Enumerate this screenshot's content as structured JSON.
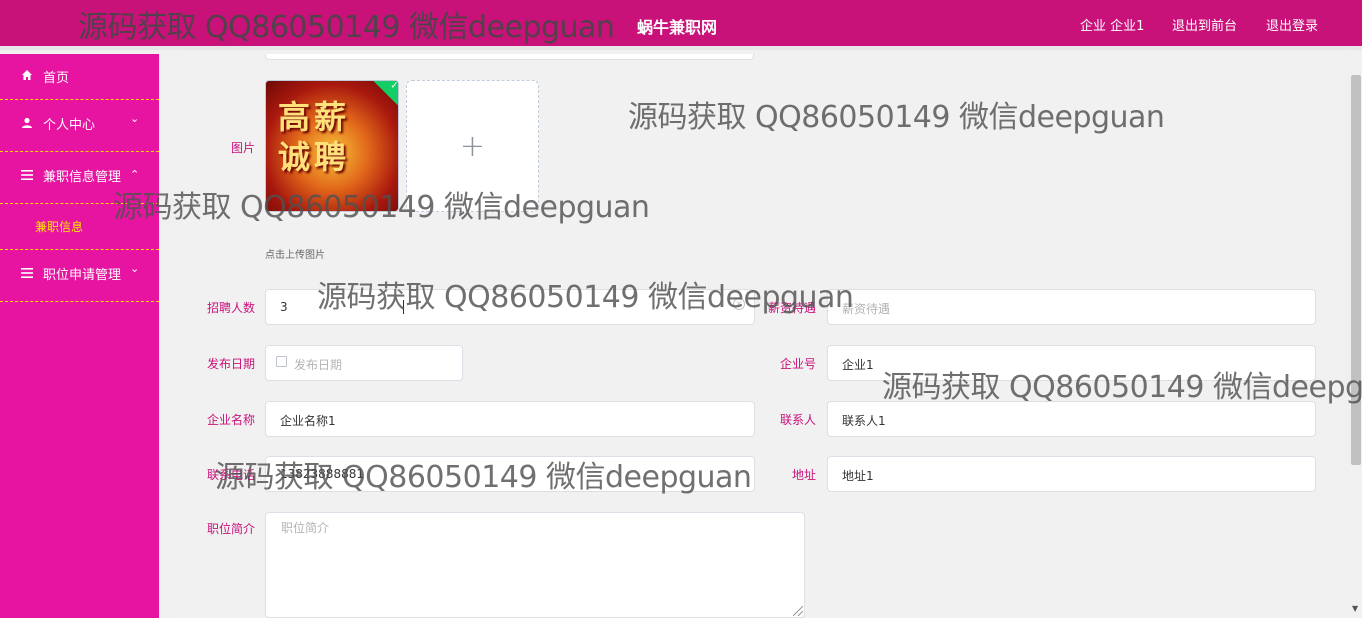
{
  "header": {
    "site_title": "蜗牛兼职网",
    "user_label": "企业 企业1",
    "back_label": "退出到前台",
    "logout_label": "退出登录"
  },
  "sidebar": {
    "items": [
      {
        "label": "首页",
        "icon": "home-icon"
      },
      {
        "label": "个人中心",
        "icon": "user-icon"
      },
      {
        "label": "兼职信息管理",
        "icon": "menu-icon",
        "expanded": true
      },
      {
        "label": "兼职信息",
        "sub": true
      },
      {
        "label": "职位申请管理",
        "icon": "menu-icon"
      }
    ]
  },
  "form": {
    "image_label": "图片",
    "image_caption": "高薪 诚聘",
    "upload_tip": "点击上传图片",
    "recruit_count_label": "招聘人数",
    "recruit_count_value": "3",
    "salary_label": "薪资待遇",
    "salary_placeholder": "薪资待遇",
    "publish_date_label": "发布日期",
    "publish_date_placeholder": "发布日期",
    "company_no_label": "企业号",
    "company_no_value": "企业1",
    "company_name_label": "企业名称",
    "company_name_value": "企业名称1",
    "contact_label": "联系人",
    "contact_value": "联系人1",
    "phone_label": "联系电话",
    "phone_value": "13823888881",
    "address_label": "地址",
    "address_value": "地址1",
    "intro_label": "职位简介",
    "intro_placeholder": "职位简介"
  },
  "watermarks": [
    "源码获取 QQ86050149 微信deepguan",
    "源码获取 QQ86050149 微信deepguan",
    "源码获取 QQ86050149 微信deepguan",
    "源码获取 QQ86050149 微信deepguan",
    "源码获取 QQ86050149 微信deepg",
    "源码获取 QQ86050149 微信deepguan"
  ],
  "colors": {
    "header_bg": "#c8127a",
    "sidebar_bg": "#e614a0",
    "sidebar_divider": "#ffd700",
    "submenu_text": "#ffe600",
    "label_text": "#c8127a"
  }
}
